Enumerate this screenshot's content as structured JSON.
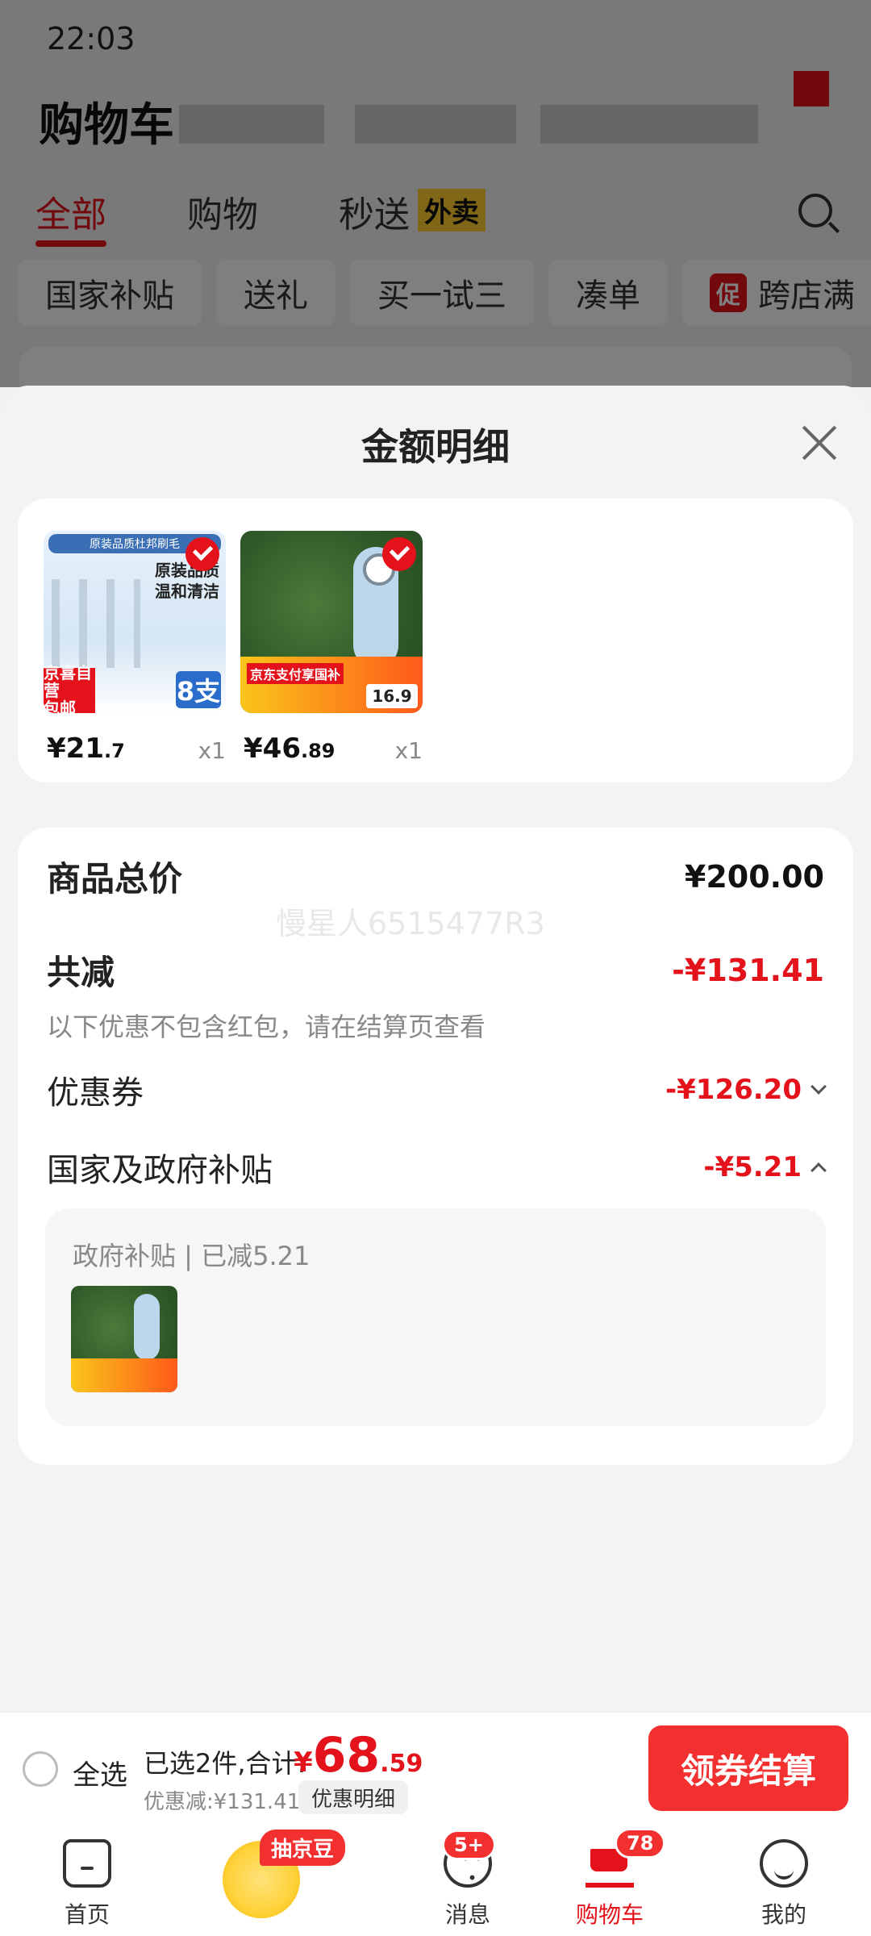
{
  "status_bar": {
    "time": "22:03"
  },
  "header": {
    "title": "购物车"
  },
  "tabs": [
    {
      "label": "全部",
      "active": true
    },
    {
      "label": "购物"
    },
    {
      "label": "秒送",
      "tag": "外卖"
    }
  ],
  "chips": [
    {
      "label": "国家补贴"
    },
    {
      "label": "送礼"
    },
    {
      "label": "买一试三"
    },
    {
      "label": "凑单"
    },
    {
      "label": "跨店满",
      "badge": "促"
    }
  ],
  "sheet": {
    "title": "金额明细",
    "products": [
      {
        "price_int": "¥21",
        "price_dec": ".7",
        "qty": "x1",
        "thumb_text": "原装品质\n温和清洁",
        "thumb_tag": "京喜自营\n包邮",
        "thumb_count": "8支",
        "banner": "原装品质杜邦刷毛"
      },
      {
        "price_int": "¥46",
        "price_dec": ".89",
        "qty": "x1",
        "thumb_banner": "京东支付享国补",
        "thumb_price": "16.9"
      }
    ],
    "summary": {
      "total_label": "商品总价",
      "total_value": "¥200.00",
      "reduce_label": "共减",
      "reduce_value": "-¥131.41",
      "note": "以下优惠不包含红包，请在结算页查看",
      "coupon_label": "优惠券",
      "coupon_value": "-¥126.20",
      "subsidy_label": "国家及政府补贴",
      "subsidy_value": "-¥5.21",
      "sub_detail": "政府补贴 | 已减5.21",
      "watermark": "慢星人6515477R3"
    }
  },
  "checkout": {
    "select_all": "全选",
    "selected": "已选2件,合计:",
    "total_yen": "¥",
    "total_int": "68",
    "total_dec": ".59",
    "discount": "优惠减:¥131.41",
    "detail_button": "优惠明细",
    "checkout_button": "领券结算"
  },
  "tabbar": {
    "items": [
      {
        "label": "首页",
        "icon": "home-icon"
      },
      {
        "label": "",
        "icon": "beans-icon",
        "badge": "抽京豆"
      },
      {
        "label": "消息",
        "icon": "message-icon",
        "badge": "5+"
      },
      {
        "label": "购物车",
        "icon": "cart-icon",
        "badge": "78",
        "active": true
      },
      {
        "label": "我的",
        "icon": "user-icon"
      }
    ]
  },
  "colors": {
    "accent": "#e3121b",
    "checkout_button": "#f23030"
  }
}
